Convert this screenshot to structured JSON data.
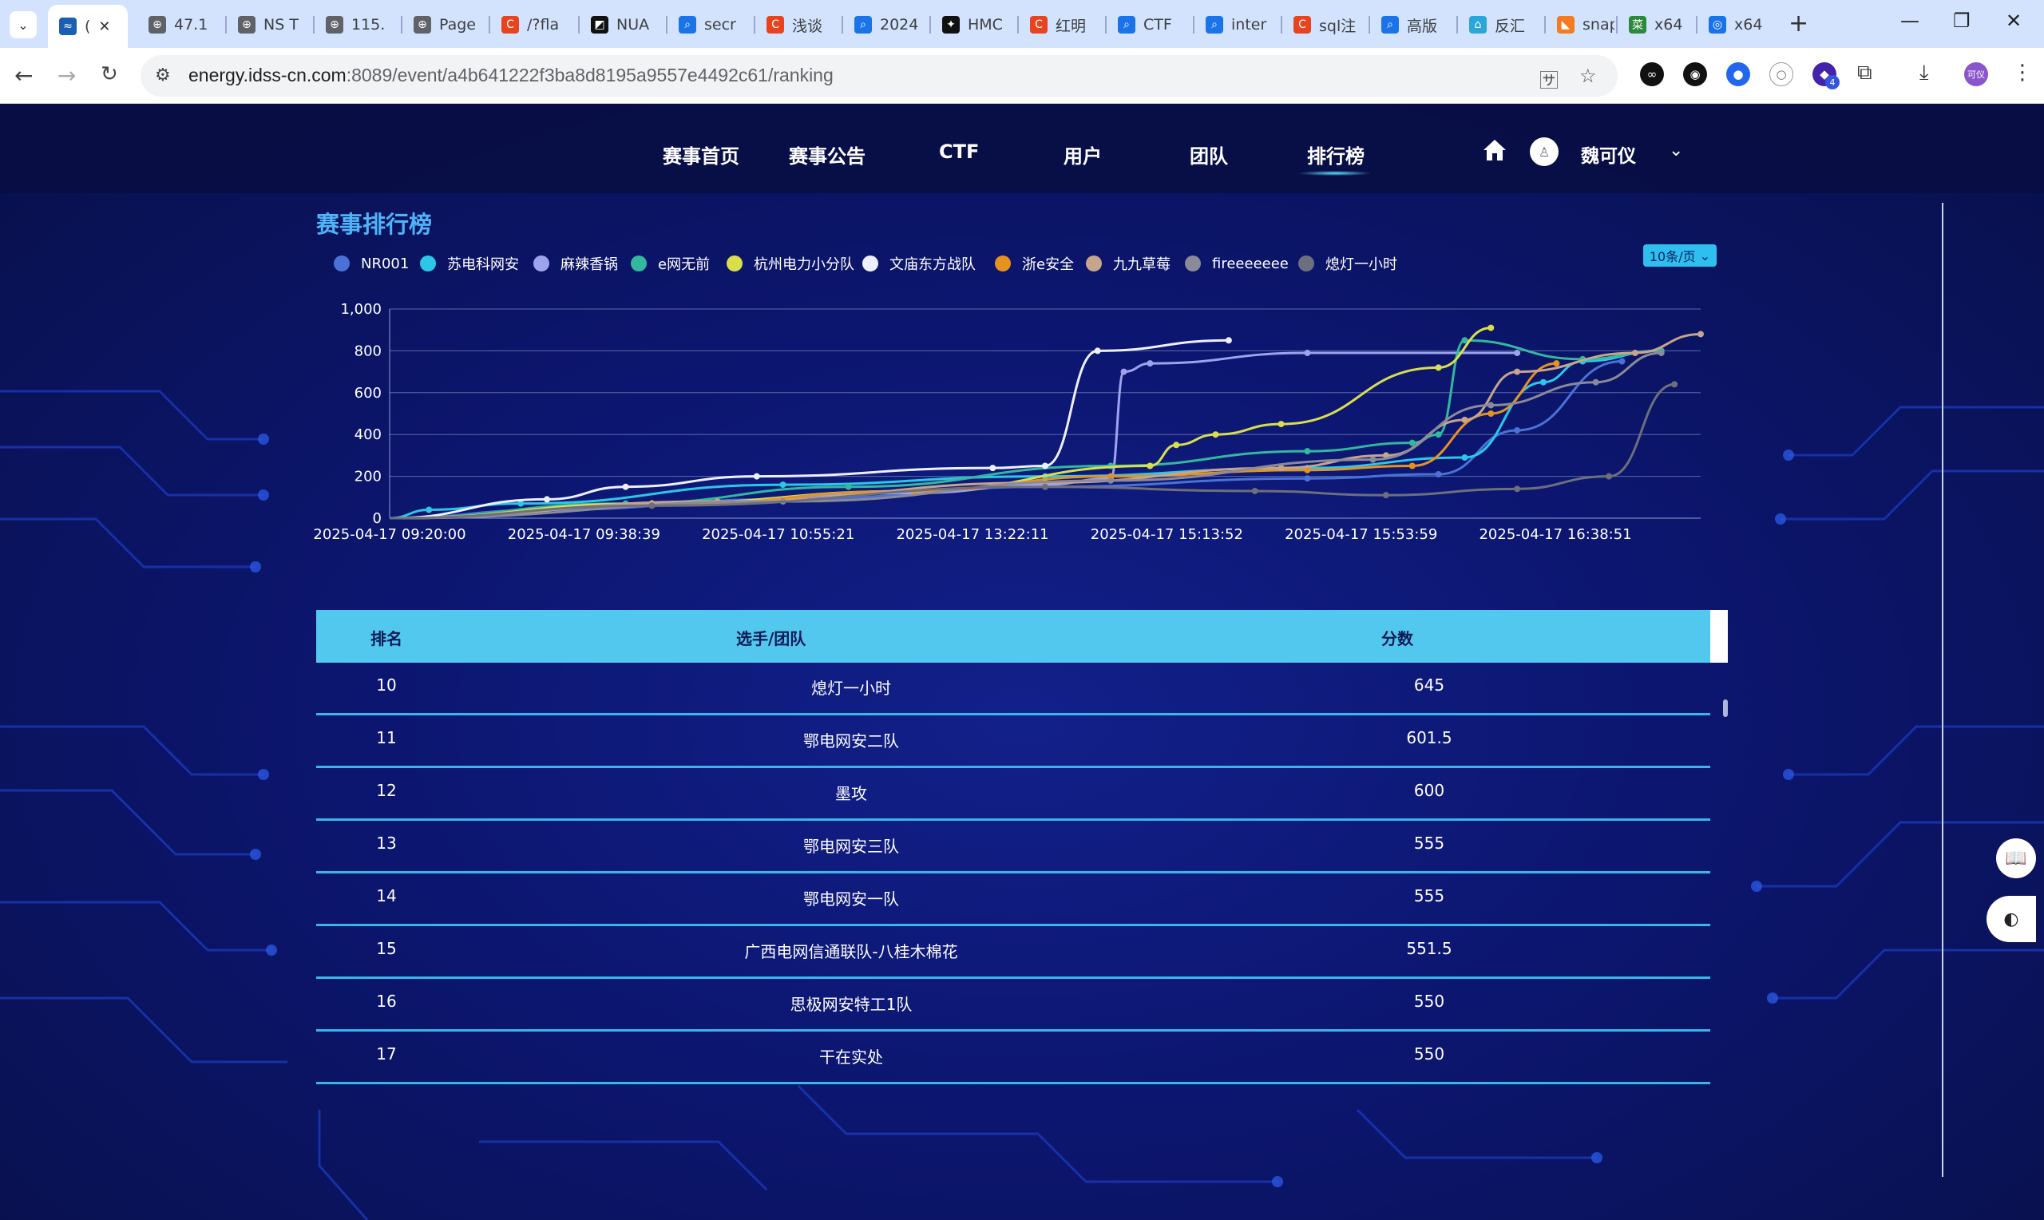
{
  "browser": {
    "tabs": [
      {
        "label": "(",
        "fav": "≈",
        "favColor": "#1a5fb4",
        "active": true
      },
      {
        "label": "47.1",
        "fav": "⊕",
        "favColor": "#5f6368"
      },
      {
        "label": "NS T",
        "fav": "⊕",
        "favColor": "#5f6368"
      },
      {
        "label": "115.",
        "fav": "⊕",
        "favColor": "#5f6368"
      },
      {
        "label": "Page",
        "fav": "⊕",
        "favColor": "#5f6368"
      },
      {
        "label": "/?fla",
        "fav": "C",
        "favColor": "#e8431f"
      },
      {
        "label": "NUA",
        "fav": "◩",
        "favColor": "#111111"
      },
      {
        "label": "secr",
        "fav": "⌕",
        "favColor": "#1a73e8"
      },
      {
        "label": "浅谈",
        "fav": "C",
        "favColor": "#e8431f"
      },
      {
        "label": "2024",
        "fav": "⌕",
        "favColor": "#1a73e8"
      },
      {
        "label": "HMC",
        "fav": "✦",
        "favColor": "#111111"
      },
      {
        "label": "红明",
        "fav": "C",
        "favColor": "#e8431f"
      },
      {
        "label": "CTF",
        "fav": "⌕",
        "favColor": "#1a73e8"
      },
      {
        "label": "inter",
        "fav": "⌕",
        "favColor": "#1a73e8"
      },
      {
        "label": "sql注",
        "fav": "C",
        "favColor": "#e8431f"
      },
      {
        "label": "高版",
        "fav": "⌕",
        "favColor": "#1a73e8"
      },
      {
        "label": "反汇",
        "fav": "⌂",
        "favColor": "#2aa7d6"
      },
      {
        "label": "snap",
        "fav": "◣",
        "favColor": "#f47b20"
      },
      {
        "label": "x64",
        "fav": "菜",
        "favColor": "#2a8a3a"
      },
      {
        "label": "x64",
        "fav": "◎",
        "favColor": "#1a73e8"
      }
    ],
    "url_host": "energy.idss-cn.com",
    "url_path": ":8089/event/a4b641222f3ba8d8195a9557e4492c61/ranking",
    "extension_badge": "4",
    "profile_label": "可仪"
  },
  "nav": {
    "items": [
      "赛事首页",
      "赛事公告",
      "CTF",
      "用户",
      "团队",
      "排行榜"
    ],
    "active": "排行榜",
    "username": "魏可仪"
  },
  "section_title": "赛事排行榜",
  "page_size_label": "10条/页",
  "chart_data": {
    "type": "line",
    "ylim": [
      0,
      1000
    ],
    "yticks": [
      "0",
      "200",
      "400",
      "600",
      "800",
      "1,000"
    ],
    "xticks": [
      "2025-04-17 09:20:00",
      "2025-04-17 09:38:39",
      "2025-04-17 10:55:21",
      "2025-04-17 13:22:11",
      "2025-04-17 15:13:52",
      "2025-04-17 15:53:59",
      "2025-04-17 16:38:51"
    ],
    "series": [
      {
        "name": "NR001",
        "color": "#4a72d6",
        "points": [
          [
            0,
            0
          ],
          [
            0.12,
            40
          ],
          [
            0.3,
            90
          ],
          [
            0.5,
            150
          ],
          [
            0.7,
            190
          ],
          [
            0.8,
            210
          ],
          [
            0.86,
            420
          ],
          [
            0.94,
            750
          ]
        ]
      },
      {
        "name": "苏电科网安",
        "color": "#2cc7e8",
        "points": [
          [
            0,
            0
          ],
          [
            0.03,
            40
          ],
          [
            0.1,
            70
          ],
          [
            0.3,
            160
          ],
          [
            0.5,
            200
          ],
          [
            0.7,
            240
          ],
          [
            0.82,
            290
          ],
          [
            0.88,
            650
          ],
          [
            0.91,
            750
          ],
          [
            0.97,
            800
          ]
        ]
      },
      {
        "name": "麻辣香锅",
        "color": "#9da3ec",
        "points": [
          [
            0,
            0
          ],
          [
            0.2,
            70
          ],
          [
            0.4,
            120
          ],
          [
            0.5,
            160
          ],
          [
            0.55,
            190
          ],
          [
            0.56,
            700
          ],
          [
            0.58,
            740
          ],
          [
            0.7,
            790
          ],
          [
            0.86,
            790
          ]
        ]
      },
      {
        "name": "e网无前",
        "color": "#32b89e",
        "points": [
          [
            0,
            0
          ],
          [
            0.18,
            70
          ],
          [
            0.35,
            150
          ],
          [
            0.55,
            250
          ],
          [
            0.7,
            320
          ],
          [
            0.78,
            360
          ],
          [
            0.8,
            400
          ],
          [
            0.82,
            850
          ],
          [
            0.91,
            760
          ],
          [
            0.97,
            800
          ]
        ]
      },
      {
        "name": "杭州电力小分队",
        "color": "#d9df4c",
        "points": [
          [
            0,
            0
          ],
          [
            0.2,
            70
          ],
          [
            0.4,
            130
          ],
          [
            0.58,
            250
          ],
          [
            0.6,
            350
          ],
          [
            0.63,
            400
          ],
          [
            0.68,
            450
          ],
          [
            0.8,
            720
          ],
          [
            0.84,
            910
          ]
        ]
      },
      {
        "name": "文庙东方战队",
        "color": "#eef0ff",
        "points": [
          [
            0,
            0
          ],
          [
            0.12,
            90
          ],
          [
            0.18,
            150
          ],
          [
            0.28,
            200
          ],
          [
            0.46,
            240
          ],
          [
            0.5,
            250
          ],
          [
            0.54,
            800
          ],
          [
            0.64,
            850
          ]
        ]
      },
      {
        "name": "浙e安全",
        "color": "#e6921e",
        "points": [
          [
            0,
            0
          ],
          [
            0.2,
            60
          ],
          [
            0.4,
            130
          ],
          [
            0.55,
            200
          ],
          [
            0.7,
            230
          ],
          [
            0.78,
            250
          ],
          [
            0.84,
            500
          ],
          [
            0.89,
            740
          ]
        ]
      },
      {
        "name": "九九草莓",
        "color": "#c7a48c",
        "points": [
          [
            0,
            0
          ],
          [
            0.25,
            80
          ],
          [
            0.5,
            170
          ],
          [
            0.68,
            240
          ],
          [
            0.76,
            300
          ],
          [
            0.82,
            470
          ],
          [
            0.86,
            700
          ],
          [
            0.95,
            790
          ],
          [
            1.0,
            880
          ]
        ]
      },
      {
        "name": "fireeeeeee",
        "color": "#8a8a98",
        "points": [
          [
            0,
            0
          ],
          [
            0.3,
            80
          ],
          [
            0.55,
            180
          ],
          [
            0.75,
            280
          ],
          [
            0.84,
            540
          ],
          [
            0.92,
            650
          ],
          [
            0.97,
            790
          ]
        ]
      },
      {
        "name": "熄灯一小时",
        "color": "#6d6f7c",
        "points": [
          [
            0,
            0
          ],
          [
            0.2,
            60
          ],
          [
            0.5,
            150
          ],
          [
            0.66,
            130
          ],
          [
            0.76,
            110
          ],
          [
            0.86,
            140
          ],
          [
            0.93,
            200
          ],
          [
            0.98,
            640
          ]
        ]
      }
    ]
  },
  "table": {
    "headers": [
      "排名",
      "选手/团队",
      "分数"
    ],
    "rows": [
      {
        "rank": "10",
        "team": "熄灯一小时",
        "score": "645"
      },
      {
        "rank": "11",
        "team": "鄂电网安二队",
        "score": "601.5"
      },
      {
        "rank": "12",
        "team": "墨攻",
        "score": "600"
      },
      {
        "rank": "13",
        "team": "鄂电网安三队",
        "score": "555"
      },
      {
        "rank": "14",
        "team": "鄂电网安一队",
        "score": "555"
      },
      {
        "rank": "15",
        "team": "广西电网信通联队-八桂木棉花",
        "score": "551.5"
      },
      {
        "rank": "16",
        "team": "思极网安特工1队",
        "score": "550"
      },
      {
        "rank": "17",
        "team": "干在实处",
        "score": "550"
      }
    ]
  }
}
